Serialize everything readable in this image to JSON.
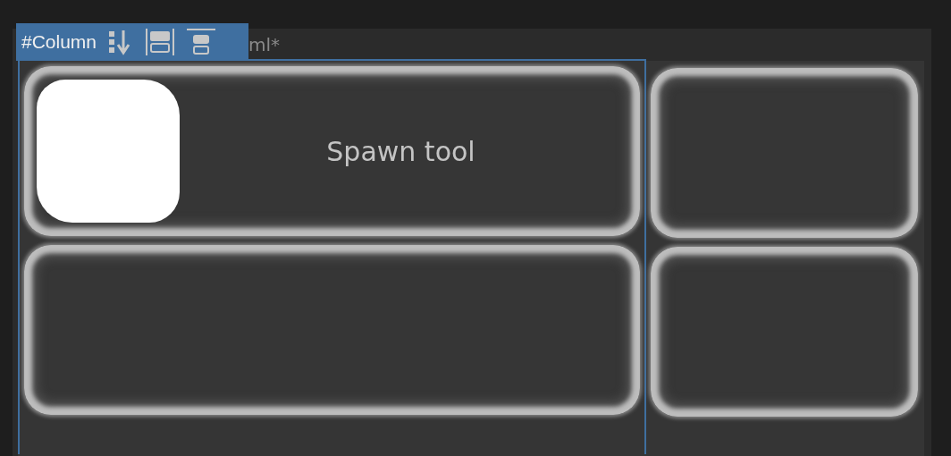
{
  "tab_title": "ml*",
  "selection": {
    "label": "#Column"
  },
  "columns": [
    {
      "selected": true,
      "cards": [
        {
          "kind": "thumbnail",
          "label": "Spawn tool"
        },
        {
          "kind": "empty"
        }
      ]
    },
    {
      "selected": false,
      "cards": [
        {
          "kind": "empty"
        },
        {
          "kind": "empty"
        }
      ]
    }
  ]
}
